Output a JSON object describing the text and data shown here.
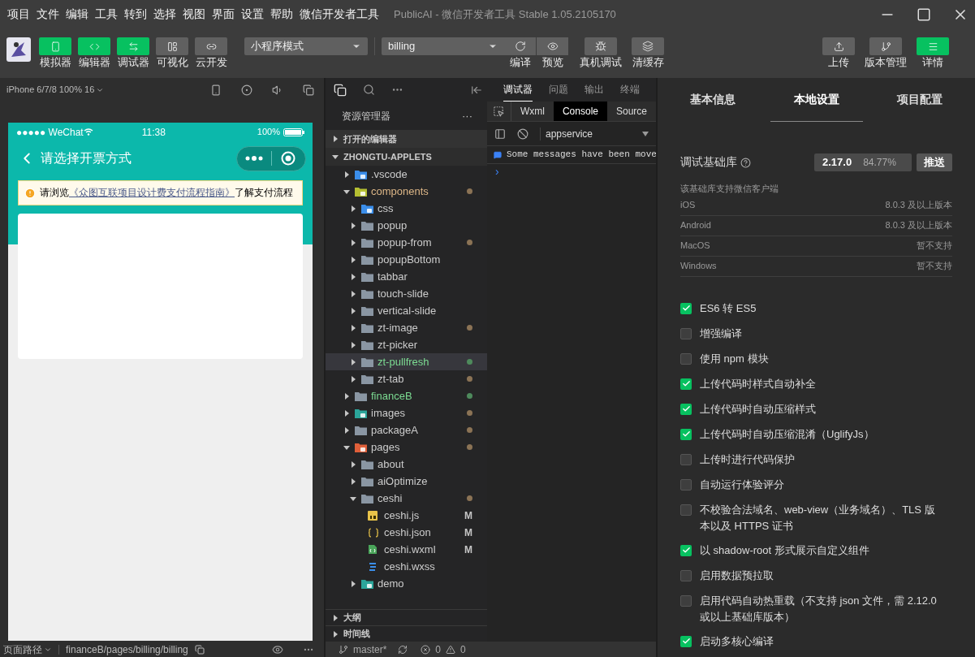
{
  "menu": {
    "items": [
      "项目",
      "文件",
      "编辑",
      "工具",
      "转到",
      "选择",
      "视图",
      "界面",
      "设置",
      "帮助",
      "微信开发者工具"
    ],
    "title": "PublicAI - 微信开发者工具 Stable 1.05.2105170"
  },
  "toolbar": {
    "view_buttons": [
      {
        "label": "模拟器",
        "kind": "phone",
        "on": true
      },
      {
        "label": "编辑器",
        "kind": "code",
        "on": true
      },
      {
        "label": "调试器",
        "kind": "swap",
        "on": true
      },
      {
        "label": "可视化",
        "kind": "layout",
        "on": false
      },
      {
        "label": "云开发",
        "kind": "cloud",
        "on": false
      }
    ],
    "mode_select": "小程序模式",
    "compile_select": "billing",
    "actions": [
      {
        "label": "编译",
        "kind": "refresh"
      },
      {
        "label": "预览",
        "kind": "eye"
      },
      {
        "label": "真机调试",
        "kind": "bug"
      },
      {
        "label": "清缓存",
        "kind": "layers"
      }
    ],
    "right_buttons": [
      {
        "label": "上传",
        "kind": "upload",
        "on": false
      },
      {
        "label": "版本管理",
        "kind": "branch",
        "on": false
      },
      {
        "label": "详情",
        "kind": "menu",
        "on": true
      }
    ]
  },
  "simulator": {
    "device": "iPhone 6/7/8 100% 16",
    "phone": {
      "carrier": "●●●●● WeChat",
      "time": "11:38",
      "battery": "100%",
      "title": "请选择开票方式",
      "notice": {
        "prefix": "请浏览",
        "link": "《众图互联项目设计费支付流程指南》",
        "suffix": "了解支付流程"
      }
    },
    "page_path_label": "页面路径",
    "page_path": "financeB/pages/billing/billing"
  },
  "explorer": {
    "title": "资源管理器",
    "more": "···",
    "open_editors": {
      "label": "打开的编辑器",
      "expanded": false
    },
    "project": {
      "label": "ZHONGTU-APPLETS",
      "expanded": true,
      "children": [
        {
          "name": ".vscode",
          "kind": "vscode",
          "expanded": false,
          "selected": false
        },
        {
          "name": "components",
          "kind": "components",
          "expanded": true,
          "selected": false,
          "color": "#8b7355",
          "tinted": true,
          "children": [
            {
              "name": "css",
              "kind": "css",
              "expanded": false,
              "selected": false
            },
            {
              "name": "popup",
              "kind": "folder",
              "expanded": false,
              "selected": false
            },
            {
              "name": "popup-from",
              "kind": "folder",
              "expanded": false,
              "selected": false,
              "color": "#8b7355",
              "tinted": false
            },
            {
              "name": "popupBottom",
              "kind": "folder",
              "expanded": false,
              "selected": false
            },
            {
              "name": "tabbar",
              "kind": "folder",
              "expanded": false,
              "selected": false
            },
            {
              "name": "touch-slide",
              "kind": "folder",
              "expanded": false,
              "selected": false
            },
            {
              "name": "vertical-slide",
              "kind": "folder",
              "expanded": false,
              "selected": false
            },
            {
              "name": "zt-image",
              "kind": "folder",
              "expanded": false,
              "selected": false,
              "color": "#8b7355",
              "tinted": false
            },
            {
              "name": "zt-picker",
              "kind": "folder",
              "expanded": false,
              "selected": false
            },
            {
              "name": "zt-pullfresh",
              "kind": "folder",
              "expanded": false,
              "selected": true,
              "color": "#4e8a5c",
              "tinted": true
            },
            {
              "name": "zt-tab",
              "kind": "folder",
              "expanded": false,
              "selected": false,
              "color": "#8b7355",
              "tinted": false
            }
          ]
        },
        {
          "name": "financeB",
          "kind": "folder",
          "expanded": false,
          "selected": false,
          "color": "#4e8a5c",
          "tinted": true
        },
        {
          "name": "images",
          "kind": "images",
          "expanded": false,
          "selected": false,
          "color": "#8b7355",
          "tinted": false
        },
        {
          "name": "packageA",
          "kind": "folder",
          "expanded": false,
          "selected": false,
          "color": "#8b7355",
          "tinted": false
        },
        {
          "name": "pages",
          "kind": "pages",
          "expanded": true,
          "selected": false,
          "color": "#8b7355",
          "tinted": false,
          "children": [
            {
              "name": "about",
              "kind": "folder",
              "expanded": false,
              "selected": false
            },
            {
              "name": "aiOptimize",
              "kind": "folder",
              "expanded": false,
              "selected": false
            },
            {
              "name": "ceshi",
              "kind": "folder",
              "expanded": true,
              "selected": false,
              "color": "#8b7355",
              "tinted": false,
              "children": [
                {
                  "name": "ceshi.js",
                  "kind": "js",
                  "selected": false,
                  "badge": "M"
                },
                {
                  "name": "ceshi.json",
                  "kind": "json",
                  "selected": false,
                  "badge": "M"
                },
                {
                  "name": "ceshi.wxml",
                  "kind": "wxml",
                  "selected": false,
                  "badge": "M"
                },
                {
                  "name": "ceshi.wxss",
                  "kind": "wxss",
                  "selected": false
                }
              ]
            },
            {
              "name": "demo",
              "kind": "images",
              "expanded": false,
              "selected": false
            }
          ]
        }
      ]
    },
    "bottom_sections": [
      {
        "label": "大纲",
        "expanded": false
      },
      {
        "label": "时间线",
        "expanded": false
      }
    ]
  },
  "debugger": {
    "tabs": [
      {
        "label": "调试器",
        "selected": true
      },
      {
        "label": "问题",
        "selected": false
      },
      {
        "label": "输出",
        "selected": false
      },
      {
        "label": "终端",
        "selected": false
      }
    ],
    "panel_tabs": [
      {
        "label": "Wxml",
        "selected": false
      },
      {
        "label": "Console",
        "selected": true
      },
      {
        "label": "Source",
        "selected": false
      }
    ],
    "context": "appservice",
    "messages": [
      "Some messages have been move"
    ],
    "prompt": "›"
  },
  "status_bar": {
    "branch": "master*",
    "errors": "0",
    "warnings": "0"
  },
  "settings": {
    "tabs": [
      {
        "label": "基本信息",
        "selected": false
      },
      {
        "label": "本地设置",
        "selected": true
      },
      {
        "label": "项目配置",
        "selected": false
      }
    ],
    "library": {
      "label": "调试基础库",
      "version": "2.17.0",
      "share": "84.77%",
      "push": "推送"
    },
    "support_heading": "该基础库支持微信客户端",
    "support": [
      {
        "platform": "iOS",
        "value": "8.0.3 及以上版本"
      },
      {
        "platform": "Android",
        "value": "8.0.3 及以上版本"
      },
      {
        "platform": "MacOS",
        "value": "暂不支持"
      },
      {
        "platform": "Windows",
        "value": "暂不支持"
      }
    ],
    "options": [
      {
        "label": "ES6 转 ES5",
        "checked": true
      },
      {
        "label": "增强编译",
        "checked": false
      },
      {
        "label": "使用 npm 模块",
        "checked": false
      },
      {
        "label": "上传代码时样式自动补全",
        "checked": true
      },
      {
        "label": "上传代码时自动压缩样式",
        "checked": true
      },
      {
        "label": "上传代码时自动压缩混淆（UglifyJs）",
        "checked": true
      },
      {
        "label": "上传时进行代码保护",
        "checked": false
      },
      {
        "label": "自动运行体验评分",
        "checked": false
      },
      {
        "label": "不校验合法域名、web-view（业务域名）、TLS 版本以及 HTTPS 证书",
        "checked": false
      },
      {
        "label": "以 shadow-root 形式展示自定义组件",
        "checked": true
      },
      {
        "label": "启用数据预拉取",
        "checked": false
      },
      {
        "label": "启用代码自动热重载（不支持 json 文件，需 2.12.0 或以上基础库版本）",
        "checked": false
      },
      {
        "label": "启动多核心编译",
        "checked": true
      }
    ]
  }
}
